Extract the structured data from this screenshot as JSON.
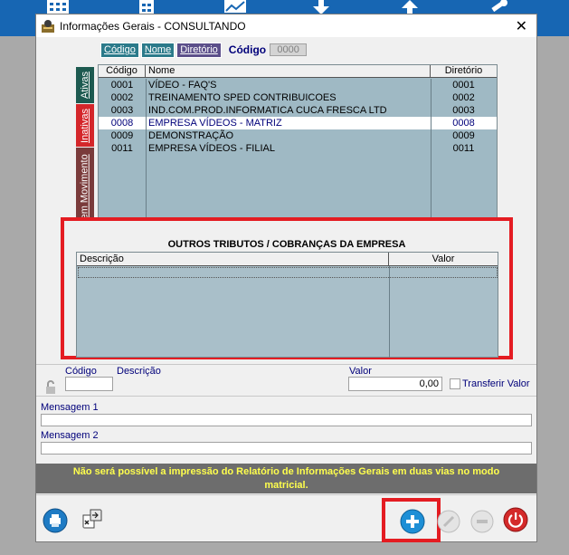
{
  "window": {
    "title": "Informações Gerais  -  CONSULTANDO",
    "close_glyph": "✕"
  },
  "tabs": {
    "codigo": "Código",
    "nome": "Nome",
    "diretorio": "Diretório",
    "search_label": "Código",
    "search_value": "0000"
  },
  "side_tabs": {
    "ativas": "Ativas",
    "inativas": "Inativas",
    "sem_movimento": "Sem Movimento"
  },
  "companies": {
    "headers": {
      "code": "Código",
      "name": "Nome",
      "dir": "Diretório"
    },
    "rows": [
      {
        "code": "0001",
        "name": "VÍDEO - FAQ'S",
        "dir": "0001"
      },
      {
        "code": "0002",
        "name": "TREINAMENTO SPED CONTRIBUICOES",
        "dir": "0002"
      },
      {
        "code": "0003",
        "name": "IND.COM.PROD.INFORMATICA CUCA FRESCA LTD",
        "dir": "0003"
      },
      {
        "code": "0008",
        "name": "EMPRESA VÍDEOS - MATRIZ",
        "dir": "0008"
      },
      {
        "code": "0009",
        "name": "DEMONSTRAÇÃO",
        "dir": "0009"
      },
      {
        "code": "0011",
        "name": "EMPRESA VÍDEOS - FILIAL",
        "dir": "0011"
      }
    ],
    "selected_index": 3
  },
  "outros": {
    "title": "OUTROS TRIBUTOS / COBRANÇAS DA EMPRESA",
    "col_desc": "Descrição",
    "col_valor": "Valor"
  },
  "form": {
    "codigo_label": "Código",
    "descricao_label": "Descrição",
    "valor_label": "Valor",
    "valor_value": "0,00",
    "transferir_label": "Transferir Valor"
  },
  "messages": {
    "msg1_label": "Mensagem 1",
    "msg2_label": "Mensagem 2"
  },
  "warning": {
    "line1": "Não será possível a impressão do Relatório de Informações Gerais em duas vias no modo",
    "line2": "matricial."
  },
  "icons": {
    "print": "printer-icon",
    "export": "export-icon",
    "add": "plus-icon",
    "power": "power-icon"
  },
  "colors": {
    "topbar": "#1766b3",
    "highlight_red": "#e41c22",
    "grid_bg": "#9fb9c4",
    "warning_text": "#ffff4d"
  }
}
